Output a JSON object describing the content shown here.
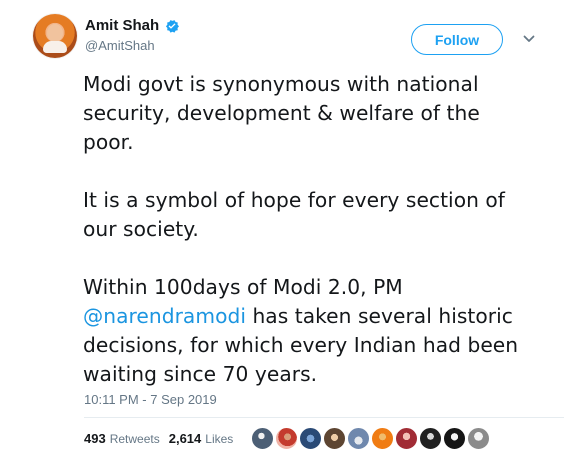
{
  "tweet": {
    "author": {
      "display_name": "Amit Shah",
      "handle": "@AmitShah",
      "verified": true
    },
    "follow_button": "Follow",
    "more_icon": "chevron-down-icon",
    "paragraph_1": "Modi govt is synonymous with national security, development & welfare of the poor.",
    "paragraph_2": "It is a symbol of hope for every section of our society.",
    "paragraph_3": {
      "before_mention": "Within 100days of Modi 2.0, PM ",
      "mention": "@narendramodi",
      "after_mention": " has taken several historic decisions, for which every Indian had been waiting since 70 years."
    },
    "timestamp": "10:11 PM - 7 Sep 2019",
    "stats": {
      "retweets_count": "493",
      "retweets_label": "Retweets",
      "likes_count": "2,614",
      "likes_label": "Likes"
    },
    "colors": {
      "accent": "#1da1f2",
      "mention": "#1b95e0",
      "muted": "#657786",
      "divider": "#e6ecf0"
    }
  }
}
